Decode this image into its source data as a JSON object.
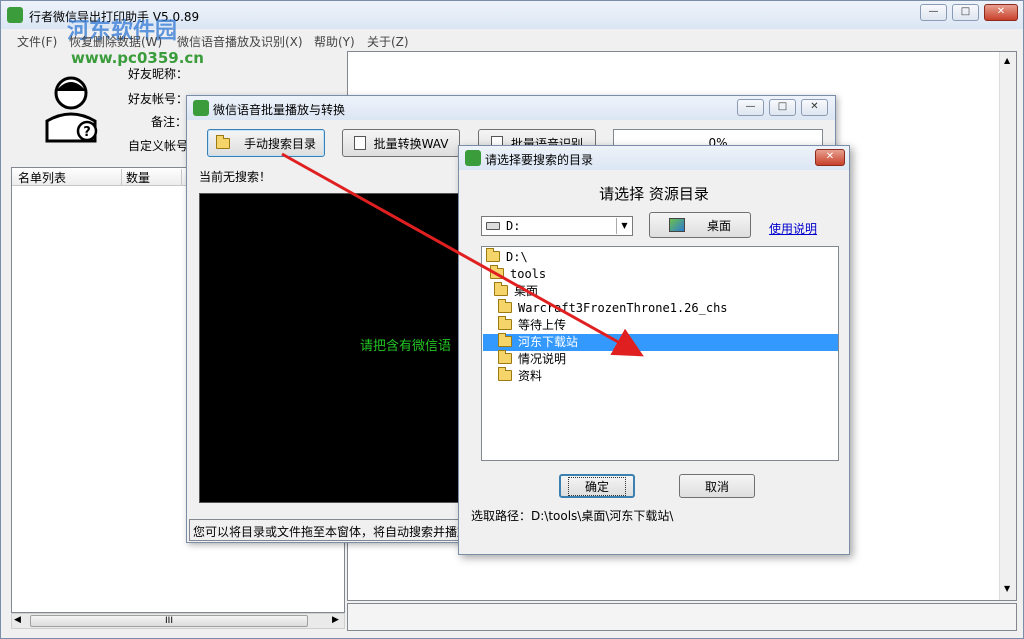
{
  "main_window": {
    "title": "行者微信导出打印助手 V5.0.89",
    "watermark_site": "河东软件园",
    "watermark_url": "www.pc0359.cn",
    "menu": [
      "文件(F)",
      "恢复删除数据(W)",
      "微信语音播放及识别(X)",
      "帮助(Y)",
      "关于(Z)"
    ],
    "profile": {
      "nickname_label": "好友昵称：",
      "account_label": "好友帐号：",
      "remark_label": "备注：",
      "custom_account_label": "自定义帐号"
    },
    "list_headers": [
      "名单列表",
      "数量"
    ],
    "scroll_thumb_glyph": "III"
  },
  "voice_window": {
    "title": "微信语音批量播放与转换",
    "btn_search": "手动搜索目录",
    "btn_convert": "批量转换WAV",
    "btn_recognize": "批量语音识别",
    "progress_text": "0%",
    "status": "当前无搜索！",
    "console_text": "请把含有微信语",
    "bottom_hint": "您可以将目录或文件拖至本窗体，将自动搜索并播放"
  },
  "dialog": {
    "title": "请选择要搜索的目录",
    "heading": "请选择 资源目录",
    "drive": "D:",
    "desktop_btn": "桌面",
    "help_link": "使用说明",
    "tree": [
      "D:\\",
      "tools",
      "桌面",
      "Warcraft3FrozenThrone1.26_chs",
      "等待上传",
      "河东下载站",
      "情况说明",
      "资料"
    ],
    "selected_index": 5,
    "ok": "确定",
    "cancel": "取消",
    "path_label": "选取路径：D:\\tools\\桌面\\河东下载站\\"
  },
  "colors": {
    "selection": "#3399ff",
    "console_bg": "#000000",
    "console_text": "#22c322",
    "arrow": "#e02020",
    "link": "#0000cc"
  }
}
